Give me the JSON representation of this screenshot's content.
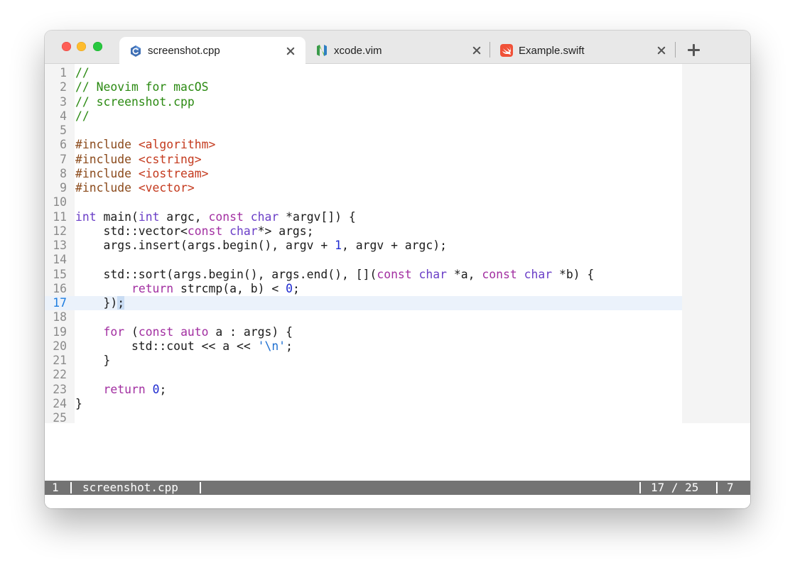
{
  "window": {
    "tabs": [
      {
        "label": "screenshot.cpp",
        "icon": "cpp-file-icon",
        "active": true
      },
      {
        "label": "xcode.vim",
        "icon": "neovim-file-icon",
        "active": false
      },
      {
        "label": "Example.swift",
        "icon": "swift-file-icon",
        "active": false
      }
    ]
  },
  "editor": {
    "current_line": 17,
    "lines": [
      {
        "n": "1",
        "tokens": [
          [
            "c",
            "//"
          ]
        ]
      },
      {
        "n": "2",
        "tokens": [
          [
            "c",
            "// Neovim for macOS"
          ]
        ]
      },
      {
        "n": "3",
        "tokens": [
          [
            "c",
            "// screenshot.cpp"
          ]
        ]
      },
      {
        "n": "4",
        "tokens": [
          [
            "c",
            "//"
          ]
        ]
      },
      {
        "n": "5",
        "tokens": []
      },
      {
        "n": "6",
        "tokens": [
          [
            "p",
            "#include "
          ],
          [
            "s",
            "<algorithm>"
          ]
        ]
      },
      {
        "n": "7",
        "tokens": [
          [
            "p",
            "#include "
          ],
          [
            "s",
            "<cstring>"
          ]
        ]
      },
      {
        "n": "8",
        "tokens": [
          [
            "p",
            "#include "
          ],
          [
            "s",
            "<iostream>"
          ]
        ]
      },
      {
        "n": "9",
        "tokens": [
          [
            "p",
            "#include "
          ],
          [
            "s",
            "<vector>"
          ]
        ]
      },
      {
        "n": "10",
        "tokens": []
      },
      {
        "n": "11",
        "tokens": [
          [
            "t",
            "int"
          ],
          [
            "x",
            " main("
          ],
          [
            "t",
            "int"
          ],
          [
            "x",
            " argc, "
          ],
          [
            "k",
            "const"
          ],
          [
            "x",
            " "
          ],
          [
            "t",
            "char"
          ],
          [
            "x",
            " *argv[]) {"
          ]
        ]
      },
      {
        "n": "12",
        "tokens": [
          [
            "x",
            "    std::vector<"
          ],
          [
            "k",
            "const"
          ],
          [
            "x",
            " "
          ],
          [
            "t",
            "char"
          ],
          [
            "x",
            "*> args;"
          ]
        ]
      },
      {
        "n": "13",
        "tokens": [
          [
            "x",
            "    args.insert(args.begin(), argv + "
          ],
          [
            "n",
            "1"
          ],
          [
            "x",
            ", argv + argc);"
          ]
        ]
      },
      {
        "n": "14",
        "tokens": []
      },
      {
        "n": "15",
        "tokens": [
          [
            "x",
            "    std::sort(args.begin(), args.end(), []("
          ],
          [
            "k",
            "const"
          ],
          [
            "x",
            " "
          ],
          [
            "t",
            "char"
          ],
          [
            "x",
            " *a, "
          ],
          [
            "k",
            "const"
          ],
          [
            "x",
            " "
          ],
          [
            "t",
            "char"
          ],
          [
            "x",
            " *b) {"
          ]
        ]
      },
      {
        "n": "16",
        "tokens": [
          [
            "x",
            "        "
          ],
          [
            "k",
            "return"
          ],
          [
            "x",
            " strcmp(a, b) < "
          ],
          [
            "n",
            "0"
          ],
          [
            "x",
            ";"
          ]
        ]
      },
      {
        "n": "17",
        "tokens": [
          [
            "x",
            "    })"
          ],
          [
            "cur",
            ";"
          ]
        ]
      },
      {
        "n": "18",
        "tokens": []
      },
      {
        "n": "19",
        "tokens": [
          [
            "x",
            "    "
          ],
          [
            "k",
            "for"
          ],
          [
            "x",
            " ("
          ],
          [
            "k",
            "const"
          ],
          [
            "x",
            " "
          ],
          [
            "k",
            "auto"
          ],
          [
            "x",
            " a : args) {"
          ]
        ]
      },
      {
        "n": "20",
        "tokens": [
          [
            "x",
            "        std::cout << a << "
          ],
          [
            "ch",
            "'\\n'"
          ],
          [
            "x",
            ";"
          ]
        ]
      },
      {
        "n": "21",
        "tokens": [
          [
            "x",
            "    }"
          ]
        ]
      },
      {
        "n": "22",
        "tokens": []
      },
      {
        "n": "23",
        "tokens": [
          [
            "x",
            "    "
          ],
          [
            "k",
            "return"
          ],
          [
            "x",
            " "
          ],
          [
            "n",
            "0"
          ],
          [
            "x",
            ";"
          ]
        ]
      },
      {
        "n": "24",
        "tokens": [
          [
            "x",
            "}"
          ]
        ]
      },
      {
        "n": "25",
        "tokens": []
      }
    ]
  },
  "statusbar": {
    "buffer_number": "1",
    "filename": "screenshot.cpp",
    "position": "17 / 25",
    "column": "7"
  },
  "colors": {
    "comment": "#2b8a12",
    "preprocessor": "#8b4a1b",
    "string": "#c43a1e",
    "keyword": "#a22fa1",
    "type": "#6a3ec7",
    "number": "#1e2ad0",
    "statusbar": "#737373"
  }
}
